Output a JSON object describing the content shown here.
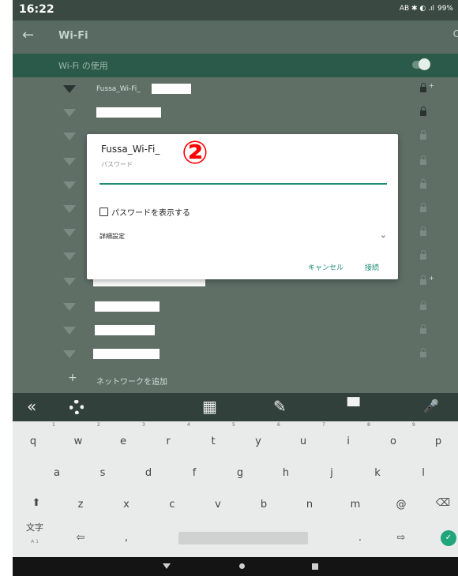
{
  "status_bar": {
    "time": "16:22",
    "indicators": "AB ✱ ◐ .ıl",
    "battery": "99%"
  },
  "app_bar": {
    "title": "Wi-Fi",
    "back_icon": "arrow-left-icon",
    "right_glyph": "C"
  },
  "wifi_toggle": {
    "label": "Wi-Fi の使用",
    "on": true
  },
  "networks": [
    {
      "name": "Fussa_Wi-Fi_",
      "redacted": true,
      "secured": true,
      "plus": true,
      "signal": "strong"
    },
    {
      "name": "",
      "redacted": true,
      "secured": true,
      "plus": false,
      "signal": "weak"
    },
    {
      "name": "",
      "redacted": true,
      "secured": true,
      "plus": false,
      "signal": "weak"
    },
    {
      "name": "",
      "redacted": true,
      "secured": true,
      "plus": false,
      "signal": "weak"
    },
    {
      "name": "",
      "redacted": true,
      "secured": true,
      "plus": false,
      "signal": "weak"
    },
    {
      "name": "",
      "redacted": true,
      "secured": true,
      "plus": false,
      "signal": "weak"
    },
    {
      "name": "",
      "redacted": true,
      "secured": true,
      "plus": false,
      "signal": "weak"
    },
    {
      "name": "",
      "redacted": true,
      "secured": true,
      "plus": false,
      "signal": "weak"
    },
    {
      "name": "",
      "redacted": true,
      "secured": true,
      "plus": true,
      "signal": "weak"
    },
    {
      "name": "",
      "redacted": true,
      "secured": true,
      "plus": false,
      "signal": "weak"
    },
    {
      "name": "",
      "redacted": true,
      "secured": true,
      "plus": false,
      "signal": "weak"
    },
    {
      "name": "",
      "redacted": true,
      "secured": true,
      "plus": false,
      "signal": "weak"
    }
  ],
  "add_network": {
    "label": "ネットワークを追加"
  },
  "dialog": {
    "title": "Fussa_Wi-Fi_",
    "annotation": "②",
    "password_label": "パスワード",
    "password_value": "",
    "show_password_label": "パスワードを表示する",
    "advanced_label": "詳細設定",
    "cancel_label": "キャンセル",
    "connect_label": "接続"
  },
  "keyboard": {
    "toolbar": {
      "collapse": "«",
      "keypad": "▦",
      "edit": "✎",
      "theme": "▀",
      "mic": "🎤"
    },
    "row1": [
      "q",
      "w",
      "e",
      "r",
      "t",
      "y",
      "u",
      "i",
      "o",
      "p"
    ],
    "row1_numbers": [
      "1",
      "2",
      "3",
      "4",
      "5",
      "6",
      "7",
      "8",
      "9"
    ],
    "row2": [
      "a",
      "s",
      "d",
      "f",
      "g",
      "h",
      "j",
      "k",
      "l"
    ],
    "row3": [
      "z",
      "x",
      "c",
      "v",
      "b",
      "n",
      "m",
      "@"
    ],
    "shift": "⬆",
    "backspace": "⌫",
    "mode_key": "文字",
    "mode_sub": "A 1",
    "left_arrow": "⇦",
    "comma": ",",
    "period": ".",
    "right_arrow": "⇨",
    "enter": "✓"
  },
  "colors": {
    "accent": "#1f8a77",
    "annotation_red": "#ff0000",
    "enter_green": "#20a67a"
  }
}
